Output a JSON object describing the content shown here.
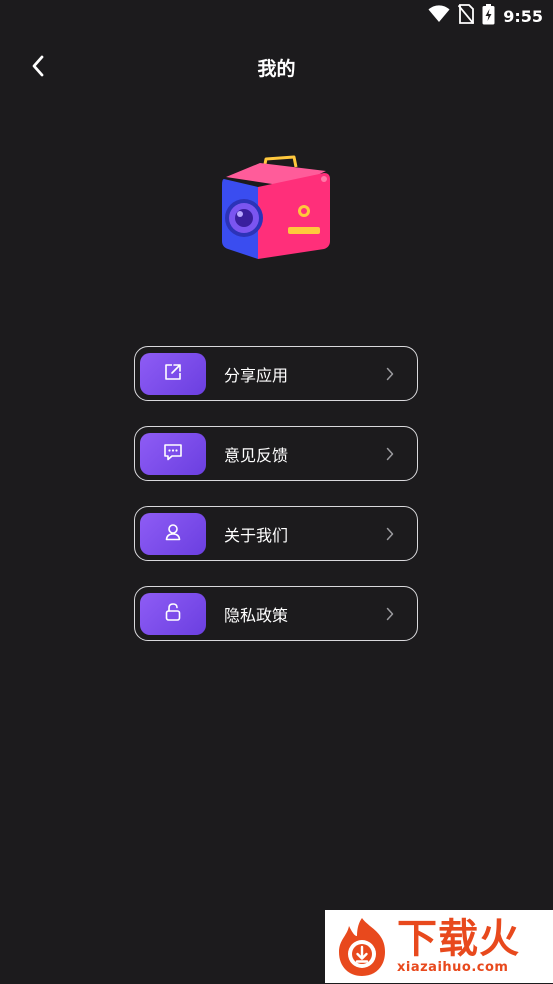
{
  "status_bar": {
    "time": "9:55",
    "icons": [
      "wifi-icon",
      "no-sim-icon",
      "battery-charging-icon"
    ]
  },
  "header": {
    "title": "我的",
    "back_icon": "chevron-left-icon"
  },
  "logo": {
    "icon": "camera-cube-logo",
    "colors": {
      "body": "#ff2f7a",
      "side": "#3a4df0",
      "lens": "#5b3ee6",
      "accent": "#ffc83d"
    }
  },
  "menu": {
    "items": [
      {
        "label": "分享应用",
        "icon": "share-icon"
      },
      {
        "label": "意见反馈",
        "icon": "feedback-icon"
      },
      {
        "label": "关于我们",
        "icon": "user-icon"
      },
      {
        "label": "隐私政策",
        "icon": "lock-icon"
      }
    ],
    "chevron_icon": "chevron-right-icon",
    "accent_color": "#7b4bf0",
    "border_color": "#d9d9dc"
  },
  "watermark": {
    "title": "下载火",
    "url": "xiazaihuo.com",
    "color": "#e8491d"
  },
  "colors": {
    "background": "#1c1b1d",
    "text": "#ffffff"
  }
}
